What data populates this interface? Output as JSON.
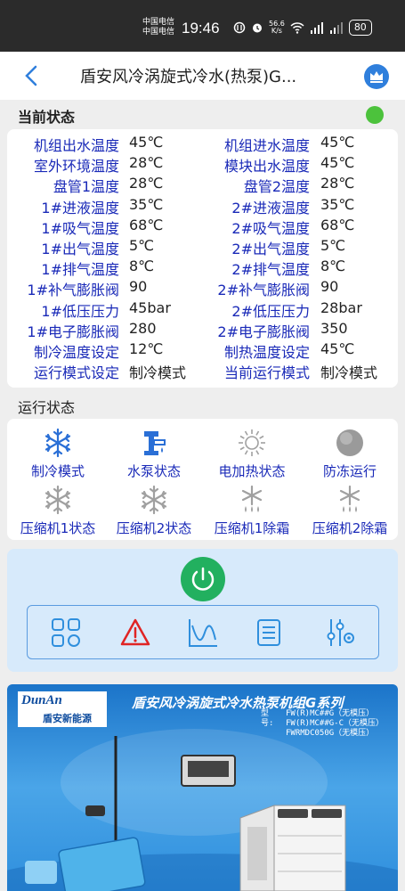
{
  "status_bar": {
    "carrier_1": "中国电信",
    "carrier_2": "中国电信",
    "time": "19:46",
    "net_speed": "56.6",
    "net_unit": "K/s",
    "battery": "80"
  },
  "header": {
    "title": "盾安风冷涡旋式冷水(热泵)G...",
    "back_icon": "back-arrow-icon",
    "crown_icon": "crown-icon"
  },
  "current_status": {
    "title": "当前状态",
    "indicator_color": "#4cc23c",
    "rows": [
      {
        "l1": "机组出水温度",
        "v1": "45℃",
        "l2": "机组进水温度",
        "v2": "45℃"
      },
      {
        "l1": "室外环境温度",
        "v1": "28℃",
        "l2": "模块出水温度",
        "v2": "45℃"
      },
      {
        "l1": "盘管1温度",
        "v1": "28℃",
        "l2": "盘管2温度",
        "v2": "28℃"
      },
      {
        "l1": "1#进液温度",
        "v1": "35℃",
        "l2": "2#进液温度",
        "v2": "35℃"
      },
      {
        "l1": "1#吸气温度",
        "v1": "68℃",
        "l2": "2#吸气温度",
        "v2": "68℃"
      },
      {
        "l1": "1#出气温度",
        "v1": "5℃",
        "l2": "2#出气温度",
        "v2": "5℃"
      },
      {
        "l1": "1#排气温度",
        "v1": "8℃",
        "l2": "2#排气温度",
        "v2": "8℃"
      },
      {
        "l1": "1#补气膨胀阀",
        "v1": "90",
        "l2": "2#补气膨胀阀",
        "v2": "90"
      },
      {
        "l1": "1#低压压力",
        "v1": "45bar",
        "l2": "2#低压压力",
        "v2": "28bar"
      },
      {
        "l1": "1#电子膨胀阀",
        "v1": "280",
        "l2": "2#电子膨胀阀",
        "v2": "350"
      },
      {
        "l1": "制冷温度设定",
        "v1": "12℃",
        "l2": "制热温度设定",
        "v2": "45℃"
      },
      {
        "l1": "运行模式设定",
        "v1": "制冷模式",
        "l2": "当前运行模式",
        "v2": "制冷模式"
      }
    ]
  },
  "run_status": {
    "title": "运行状态",
    "items": [
      {
        "label": "制冷模式",
        "icon": "snowflake-icon",
        "active": true
      },
      {
        "label": "水泵状态",
        "icon": "water-pump-icon",
        "active": true
      },
      {
        "label": "电加热状态",
        "icon": "sun-icon",
        "active": false
      },
      {
        "label": "防冻运行",
        "icon": "circle-icon",
        "active": false
      },
      {
        "label": "压缩机1状态",
        "icon": "snowflake-icon",
        "active": false
      },
      {
        "label": "压缩机2状态",
        "icon": "snowflake-icon",
        "active": false
      },
      {
        "label": "压缩机1除霜",
        "icon": "defrost-icon",
        "active": false
      },
      {
        "label": "压缩机2除霜",
        "icon": "defrost-icon",
        "active": false
      }
    ]
  },
  "controls": {
    "power_icon": "power-icon",
    "tools": [
      "grid-icon",
      "warning-icon",
      "chart-icon",
      "list-icon",
      "settings-sliders-icon"
    ],
    "accent": "#22b05f"
  },
  "banner": {
    "logo_en": "DunAn",
    "logo_cn": "盾安新能源",
    "title": "盾安风冷涡旋式冷水热泵机组G系列",
    "model_label": "型号:",
    "models": [
      "FW(R)MC##G（无模压）",
      "FW(R)MC##G-C（无模压）",
      "FWRMDC050G（无模压）"
    ]
  }
}
